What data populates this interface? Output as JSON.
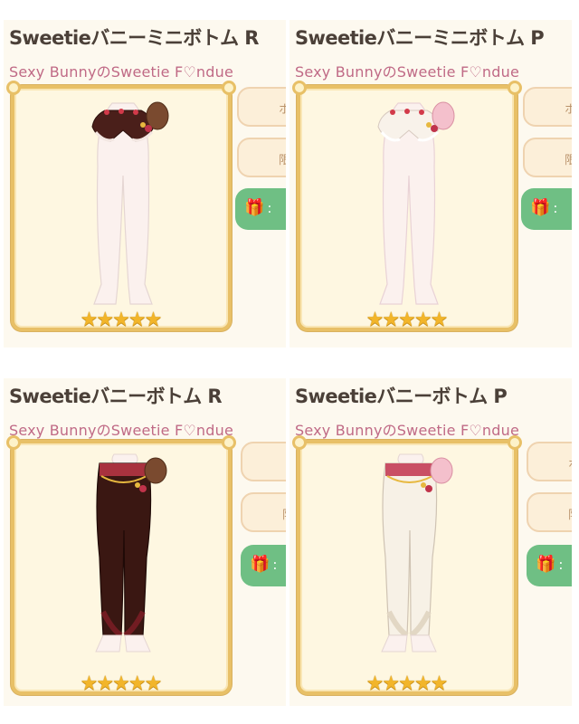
{
  "items": [
    {
      "title": "Sweetieバニーミニボトム R",
      "set_name": "Sexy BunnyのSweetie F♡ndue",
      "stars": 5,
      "side_buttons": [
        "ホ",
        "限"
      ],
      "gift_label": ":",
      "variant": "red-shorts"
    },
    {
      "title": "Sweetieバニーミニボトム P",
      "set_name": "Sexy BunnyのSweetie F♡ndue",
      "stars": 5,
      "side_buttons": [
        "ホ",
        "限"
      ],
      "gift_label": ":",
      "variant": "pink-shorts"
    },
    {
      "title": "Sweetieバニーボトム R",
      "set_name": "Sexy BunnyのSweetie F♡ndue",
      "stars": 5,
      "side_buttons": [
        "",
        "限"
      ],
      "gift_label": ":",
      "variant": "red-pants"
    },
    {
      "title": "Sweetieバニーボトム P",
      "set_name": "Sexy BunnyのSweetie F♡ndue",
      "stars": 5,
      "side_buttons": [
        "ホ",
        "限"
      ],
      "gift_label": ":",
      "variant": "pink-pants"
    }
  ],
  "icons": {
    "star": "star-icon",
    "gift": "gift-icon"
  },
  "colors": {
    "star": "#f2b52a",
    "frame_gold": "#e8c067",
    "gift_green": "#6fbf84",
    "title_text": "#4b4038",
    "subtitle_pink": "#c06a86"
  }
}
